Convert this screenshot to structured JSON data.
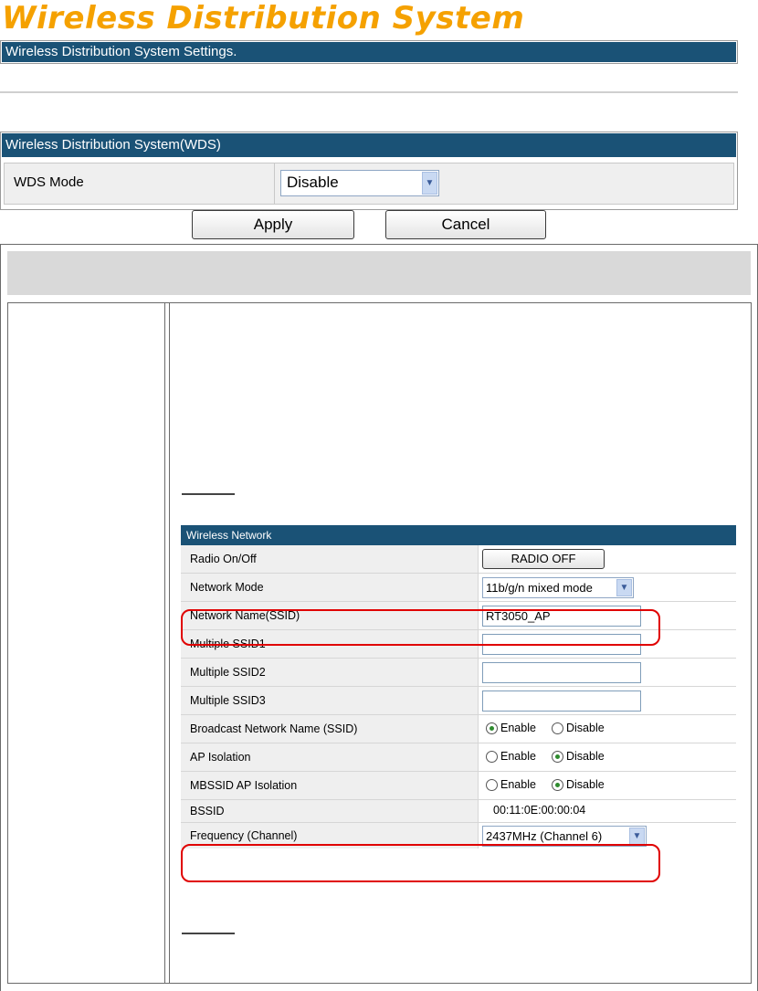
{
  "page": {
    "title": "Wireless Distribution System",
    "subtitle_bar": "Wireless Distribution System Settings."
  },
  "wds": {
    "section_title": "Wireless Distribution System(WDS)",
    "mode_label": "WDS Mode",
    "mode_value": "Disable"
  },
  "buttons": {
    "apply": "Apply",
    "cancel": "Cancel"
  },
  "wireless": {
    "section_title": "Wireless Network",
    "radio_label": "Radio On/Off",
    "radio_button": "RADIO OFF",
    "mode_label": "Network Mode",
    "mode_value": "11b/g/n mixed mode",
    "ssid_label": "Network Name(SSID)",
    "ssid_value": "RT3050_AP",
    "mssid1_label": "Multiple SSID1",
    "mssid1_value": "",
    "mssid2_label": "Multiple SSID2",
    "mssid2_value": "",
    "mssid3_label": "Multiple SSID3",
    "mssid3_value": "",
    "broadcast_label": "Broadcast Network Name (SSID)",
    "ap_isolation_label": "AP Isolation",
    "mbssid_label": "MBSSID AP Isolation",
    "enable": "Enable",
    "disable": "Disable",
    "broadcast_selected": "Enable",
    "ap_isolation_selected": "Disable",
    "mbssid_selected": "Disable",
    "bssid_label": "BSSID",
    "bssid_value": "00:11:0E:00:00:04",
    "freq_label": "Frequency (Channel)",
    "freq_value": "2437MHz (Channel 6)"
  },
  "colors": {
    "title": "#f5a100",
    "bar": "#1a5276",
    "highlight": "#e00000"
  }
}
